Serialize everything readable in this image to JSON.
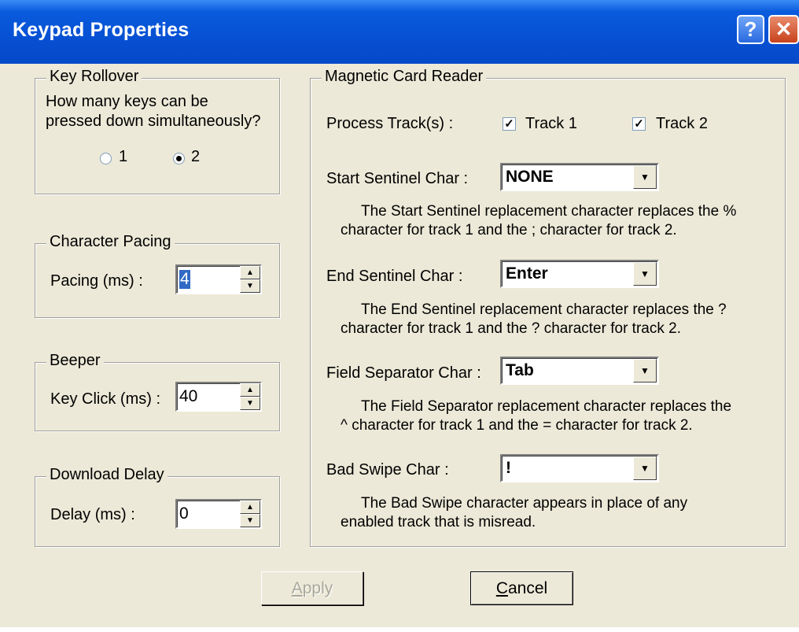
{
  "window": {
    "title": "Keypad Properties",
    "help_button": "?",
    "close_button": "✕"
  },
  "key_rollover": {
    "legend": "Key Rollover",
    "question_line1": "How many keys can be",
    "question_line2": "pressed down simultaneously?",
    "options": [
      {
        "label": "1",
        "checked": false
      },
      {
        "label": "2",
        "checked": true
      }
    ]
  },
  "character_pacing": {
    "legend": "Character Pacing",
    "label": "Pacing (ms) :",
    "value": "4"
  },
  "beeper": {
    "legend": "Beeper",
    "label": "Key Click (ms) :",
    "value": "40"
  },
  "download_delay": {
    "legend": "Download Delay",
    "label": "Delay (ms) :",
    "value": "0"
  },
  "mcr": {
    "legend": "Magnetic Card Reader",
    "process_tracks_label": "Process Track(s) :",
    "track1_label": "Track 1",
    "track1_checked": true,
    "track2_label": "Track 2",
    "track2_checked": true,
    "start_sentinel": {
      "label": "Start Sentinel Char :",
      "value": "NONE",
      "help_line1": "The Start Sentinel replacement character replaces the %",
      "help_line2": "character for track 1 and the ; character for track 2."
    },
    "end_sentinel": {
      "label": "End Sentinel Char :",
      "value": "Enter",
      "help_line1": "The End Sentinel replacement character replaces the ?",
      "help_line2": "character for track 1 and the ? character for track 2."
    },
    "field_separator": {
      "label": "Field Separator Char :",
      "value": "Tab",
      "help_line1": "The Field Separator replacement character replaces the",
      "help_line2": "^ character for track 1 and the = character for track 2."
    },
    "bad_swipe": {
      "label": "Bad Swipe Char :",
      "value": "!",
      "help_line1": "The Bad Swipe character appears in place of any",
      "help_line2": "enabled track that is misread."
    }
  },
  "buttons": {
    "apply": "Apply",
    "cancel": "Cancel"
  },
  "icons": {
    "spin_up": "▲",
    "spin_down": "▼",
    "dropdown": "▼",
    "check": "✓"
  }
}
